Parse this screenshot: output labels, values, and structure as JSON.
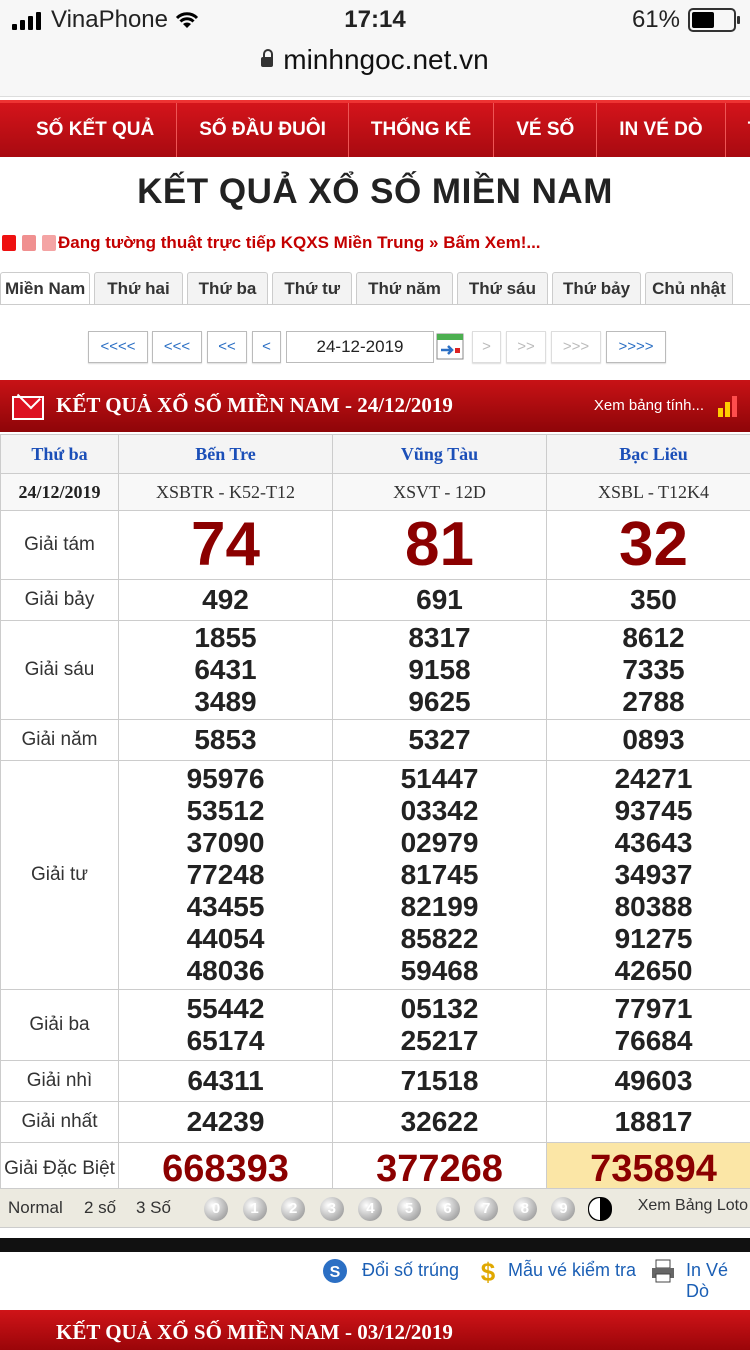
{
  "status": {
    "carrier": "VinaPhone",
    "time": "17:14",
    "battery": "61%",
    "battery_level": 0.61
  },
  "url": "minhngoc.net.vn",
  "menu": [
    "SỐ KẾT QUẢ",
    "SỐ ĐẦU ĐUÔI",
    "THỐNG KÊ",
    "VÉ SỐ",
    "IN VÉ DÒ",
    "TH"
  ],
  "page_title": "KẾT QUẢ XỔ SỐ MIỀN NAM",
  "ticker": "Đang tường thuật trực tiếp KQXS Miền Trung » Bấm Xem!...",
  "tabs": [
    "Miền Nam",
    "Thứ hai",
    "Thứ ba",
    "Thứ tư",
    "Thứ năm",
    "Thứ sáu",
    "Thứ bảy",
    "Chủ nhật"
  ],
  "pager": {
    "b1": "<<<<",
    "b2": "<<<",
    "b3": "<<",
    "b4": "<",
    "date": "24-12-2019",
    "f1": ">",
    "f2": ">>",
    "f3": ">>>",
    "f4": ">>>>"
  },
  "result": {
    "header_title": "KẾT QUẢ XỔ SỐ MIỀN NAM - 24/12/2019",
    "header_link": "Xem bảng tính...",
    "weekday": "Thứ ba",
    "date": "24/12/2019",
    "provinces": [
      "Bến Tre",
      "Vũng Tàu",
      "Bạc Liêu"
    ],
    "codes": [
      "XSBTR - K52-T12",
      "XSVT - 12D",
      "XSBL - T12K4"
    ],
    "prizes": [
      {
        "label": "Giải tám",
        "values": [
          [
            "74"
          ],
          [
            "81"
          ],
          [
            "32"
          ]
        ]
      },
      {
        "label": "Giải bảy",
        "values": [
          [
            "492"
          ],
          [
            "691"
          ],
          [
            "350"
          ]
        ]
      },
      {
        "label": "Giải sáu",
        "values": [
          [
            "1855",
            "6431",
            "3489"
          ],
          [
            "8317",
            "9158",
            "9625"
          ],
          [
            "8612",
            "7335",
            "2788"
          ]
        ]
      },
      {
        "label": "Giải năm",
        "values": [
          [
            "5853"
          ],
          [
            "5327"
          ],
          [
            "0893"
          ]
        ]
      },
      {
        "label": "Giải tư",
        "values": [
          [
            "95976",
            "53512",
            "37090",
            "77248",
            "43455",
            "44054",
            "48036"
          ],
          [
            "51447",
            "03342",
            "02979",
            "81745",
            "82199",
            "85822",
            "59468"
          ],
          [
            "24271",
            "93745",
            "43643",
            "34937",
            "80388",
            "91275",
            "42650"
          ]
        ]
      },
      {
        "label": "Giải ba",
        "values": [
          [
            "55442",
            "65174"
          ],
          [
            "05132",
            "25217"
          ],
          [
            "77971",
            "76684"
          ]
        ]
      },
      {
        "label": "Giải nhì",
        "values": [
          [
            "64311"
          ],
          [
            "71518"
          ],
          [
            "49603"
          ]
        ]
      },
      {
        "label": "Giải nhất",
        "values": [
          [
            "24239"
          ],
          [
            "32622"
          ],
          [
            "18817"
          ]
        ]
      },
      {
        "label": "Giải Đặc Biệt",
        "values": [
          [
            "668393"
          ],
          [
            "377268"
          ],
          [
            "735894"
          ]
        ]
      }
    ]
  },
  "loto": {
    "normal": "Normal",
    "two": "2 số",
    "three": "3 Số",
    "digits": [
      "0",
      "1",
      "2",
      "3",
      "4",
      "5",
      "6",
      "7",
      "8",
      "9"
    ],
    "view": "Xem Bảng Loto"
  },
  "links": {
    "doi_so": "Đổi số trúng",
    "mau_ve": "Mẫu vé kiểm tra",
    "in_ve": "In Vé Dò"
  },
  "next_header": "KẾT QUẢ XỔ SỐ MIỀN NAM - 03/12/2019",
  "colors": {
    "menu_red": "#c0101a",
    "number_red": "#8b0000",
    "link_blue": "#1b5fb5",
    "highlight": "#fbe6a6"
  }
}
